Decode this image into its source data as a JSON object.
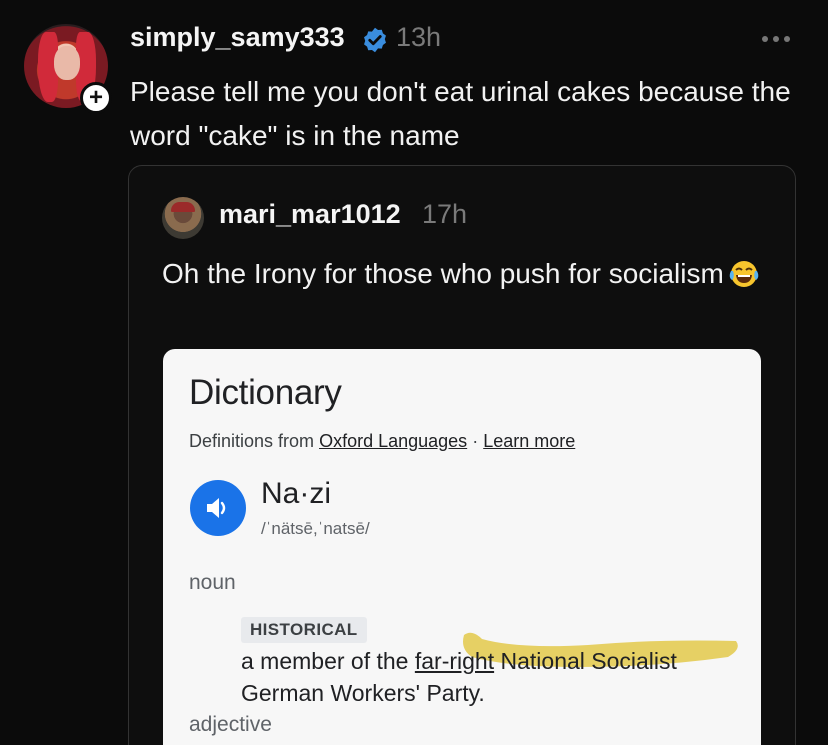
{
  "post": {
    "username": "simply_samy333",
    "time": "13h",
    "text": "Please tell me you don't eat urinal cakes because the word \"cake\" is in the name",
    "avatar_icon": "profile-avatar",
    "follow_symbol": "+"
  },
  "quoted": {
    "username": "mari_mar1012",
    "time": "17h",
    "text": "Oh the Irony for those who push for socialism",
    "emoji": "face-with-tears-of-joy"
  },
  "dictionary": {
    "title": "Dictionary",
    "source_prefix": "Definitions from",
    "source_link": "Oxford Languages",
    "separator": "·",
    "learn_more": "Learn more",
    "word": "Na·zi",
    "phonetic": "/ˈnätsē,ˈnatsē/",
    "pos_noun": "noun",
    "tag": "HISTORICAL",
    "def_before": "a member of the ",
    "def_link": "far-right",
    "def_after": " National Socialist German Workers' Party.",
    "pos_adj": "adjective"
  },
  "colors": {
    "background": "#0b0b0b",
    "verified": "#3a8dde",
    "speaker": "#1a73e8",
    "highlight": "#e3c94a"
  }
}
